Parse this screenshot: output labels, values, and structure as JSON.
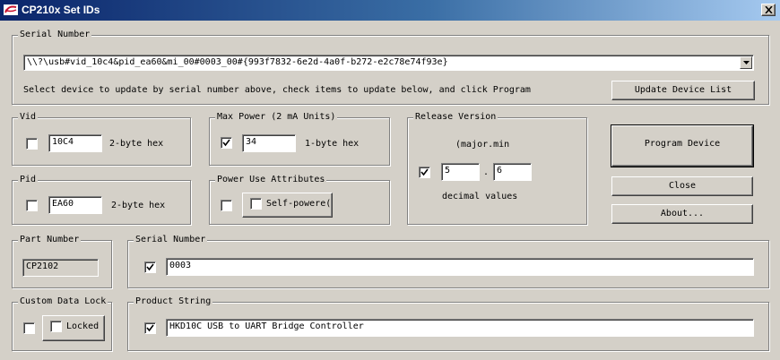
{
  "window": {
    "title": "CP210x Set IDs",
    "close_icon": "close-icon",
    "app_icon": "silabs-logo-icon"
  },
  "serial_group": {
    "label": "Serial Number",
    "device_path": "\\\\?\\usb#vid_10c4&pid_ea60&mi_00#0003_00#{993f7832-6e2d-4a0f-b272-e2c78e74f93e}",
    "instructions": "Select device to update by serial number above, check items to update below, and click Program",
    "update_button": "Update Device List"
  },
  "vid": {
    "label": "Vid",
    "value": "10C4",
    "hint": "2-byte hex",
    "checked": false
  },
  "pid": {
    "label": "Pid",
    "value": "EA60",
    "hint": "2-byte hex",
    "checked": false
  },
  "max_power": {
    "label": "Max Power (2 mA Units)",
    "value": "34",
    "hint": "1-byte hex",
    "checked": true
  },
  "power_use": {
    "label": "Power Use Attributes",
    "checked": false,
    "self_powered_label": "Self-powere(",
    "self_powered_checked": false
  },
  "release_version": {
    "label": "Release Version",
    "format": "(major.min",
    "major": "5",
    "separator": ".",
    "minor": "6",
    "hint": "decimal values",
    "checked": true
  },
  "buttons": {
    "program": "Program Device",
    "close": "Close",
    "about": "About..."
  },
  "part_number": {
    "label": "Part Number",
    "value": "CP2102"
  },
  "serial_number": {
    "label": "Serial Number",
    "value": "0003",
    "checked": true
  },
  "custom_lock": {
    "label": "Custom Data Lock",
    "checked": false,
    "locked_label": "Locked",
    "locked_checked": false
  },
  "product_string": {
    "label": "Product String",
    "value": "HKD10C USB to UART Bridge Controller",
    "checked": true
  },
  "colors": {
    "face": "#d4d0c8",
    "title_start": "#0a246a",
    "title_end": "#a6caf0",
    "highlight": "#ffffff",
    "shadow": "#808080"
  }
}
